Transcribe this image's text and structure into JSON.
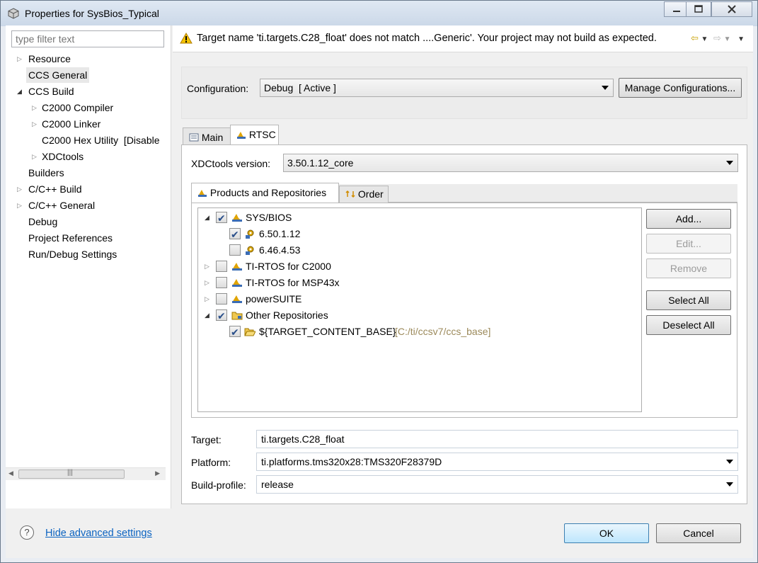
{
  "window": {
    "title": "Properties for SysBios_Typical"
  },
  "filter": {
    "placeholder": "type filter text"
  },
  "nav_tree": [
    {
      "label": "Resource"
    },
    {
      "label": "CCS General"
    },
    {
      "label": "CCS Build"
    },
    {
      "label": "C2000 Compiler"
    },
    {
      "label": "C2000 Linker"
    },
    {
      "label": "C2000 Hex Utility  [Disable"
    },
    {
      "label": "XDCtools"
    },
    {
      "label": "Builders"
    },
    {
      "label": "C/C++ Build"
    },
    {
      "label": "C/C++ General"
    },
    {
      "label": "Debug"
    },
    {
      "label": "Project References"
    },
    {
      "label": "Run/Debug Settings"
    }
  ],
  "banner": {
    "message": "Target name 'ti.targets.C28_float' does not match ....Generic'. Your project may not build as expected."
  },
  "configuration": {
    "label": "Configuration:",
    "value": "Debug  [ Active ]",
    "manage_label": "Manage Configurations..."
  },
  "tabs": [
    {
      "label": "Main"
    },
    {
      "label": "RTSC"
    }
  ],
  "xdctools": {
    "label": "XDCtools version:",
    "value": "3.50.1.12_core"
  },
  "inner_tabs": [
    {
      "label": "Products and Repositories"
    },
    {
      "label": "Order"
    }
  ],
  "products": [
    {
      "label": "SYS/BIOS",
      "checked": true
    },
    {
      "label": "6.50.1.12",
      "checked": true
    },
    {
      "label": "6.46.4.53",
      "checked": false
    },
    {
      "label": "TI-RTOS for C2000",
      "checked": false
    },
    {
      "label": "TI-RTOS for MSP43x",
      "checked": false
    },
    {
      "label": "powerSUITE",
      "checked": false
    },
    {
      "label": "Other Repositories",
      "checked": true
    },
    {
      "label": "${TARGET_CONTENT_BASE}",
      "path": "[C:/ti/ccsv7/ccs_base]",
      "checked": true
    }
  ],
  "side_buttons": {
    "add": "Add...",
    "edit": "Edit...",
    "remove": "Remove",
    "select_all": "Select All",
    "deselect_all": "Deselect All"
  },
  "target": {
    "label": "Target:",
    "value": "ti.targets.C28_float"
  },
  "platform": {
    "label": "Platform:",
    "value": "ti.platforms.tms320x28:TMS320F28379D"
  },
  "build_profile": {
    "label": "Build-profile:",
    "value": "release"
  },
  "footer": {
    "link": "Hide advanced settings",
    "ok": "OK",
    "cancel": "Cancel"
  },
  "colors": {
    "accent_link": "#0b63c1",
    "warning": "#e8a400",
    "path_text": "#9c8a5b"
  }
}
